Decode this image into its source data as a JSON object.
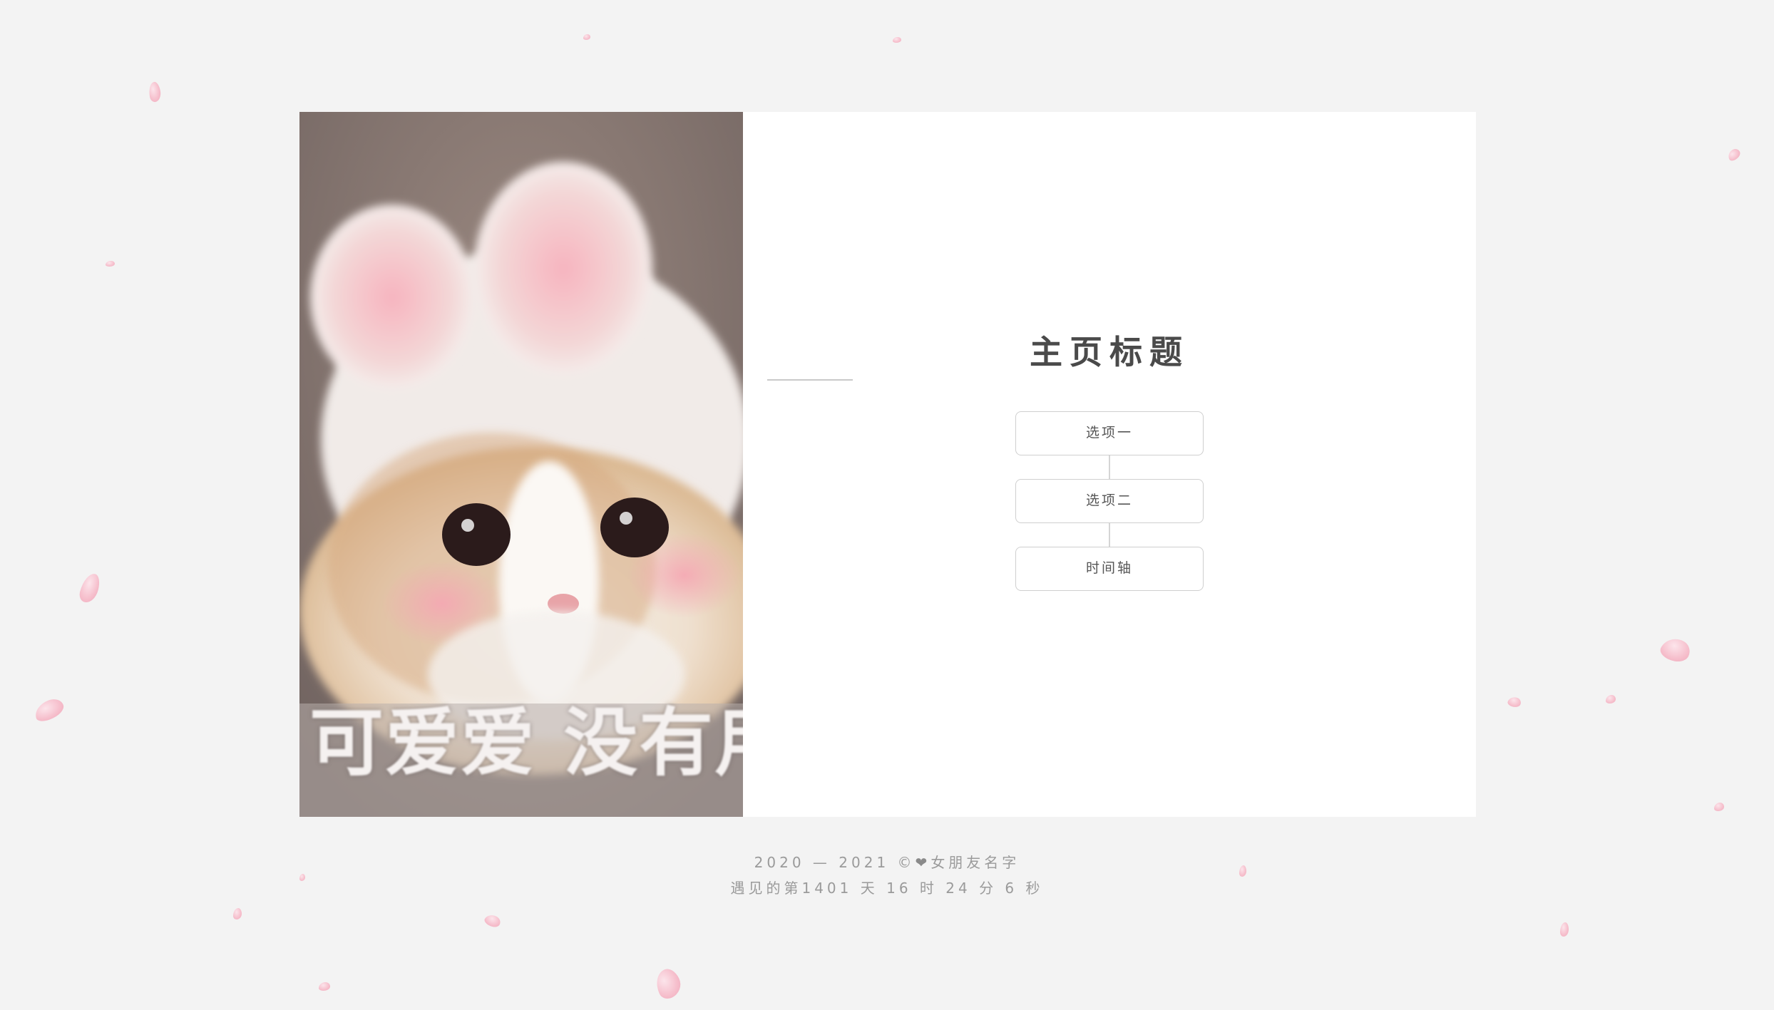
{
  "main": {
    "title": "主页标题",
    "menu": [
      {
        "label": "选项一"
      },
      {
        "label": "选项二"
      },
      {
        "label": "时间轴"
      }
    ]
  },
  "photo": {
    "caption": "可爱爱 没有用",
    "description_icon": "cat-photo"
  },
  "footer": {
    "years": "2020 — 2021 ©",
    "heart_icon": "heart-icon",
    "name": "女朋友名字",
    "counter": "遇见的第1401 天 16 时 24 分 6 秒"
  },
  "colors": {
    "background": "#f3f3f3",
    "card": "#ffffff",
    "petal": "#f6b8c7",
    "title": "#4a4a4a"
  }
}
